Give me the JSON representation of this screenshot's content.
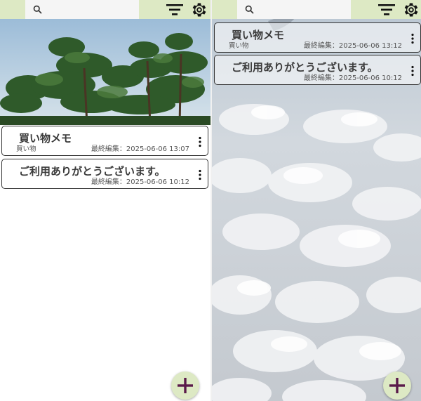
{
  "screens": [
    {
      "memos": [
        {
          "title": "買い物メモ",
          "tag": "買い物",
          "date_label": "最終編集：",
          "date": "2025-06-06 13:07"
        },
        {
          "title": "ご利用ありがとうございます。",
          "tag": "",
          "date_label": "最終編集：",
          "date": "2025-06-06 10:12"
        }
      ]
    },
    {
      "memos": [
        {
          "title": "買い物メモ",
          "tag": "買い物",
          "date_label": "最終編集：",
          "date": "2025-06-06 13:12"
        },
        {
          "title": "ご利用ありがとうございます。",
          "tag": "",
          "date_label": "最終編集：",
          "date": "2025-06-06 10:12"
        }
      ]
    }
  ],
  "icons": {
    "search": "search-icon",
    "filter": "filter-icon",
    "settings": "gear-icon",
    "more": "more-vert-icon",
    "add": "plus-icon"
  },
  "colors": {
    "toolbar_bg": "#dde9c4",
    "search_bg": "#f5f5f5",
    "fab_bg": "#dde9c4",
    "fab_plus": "#5a1a4a",
    "card_border": "#333333",
    "title_text": "#3a3a3a"
  }
}
